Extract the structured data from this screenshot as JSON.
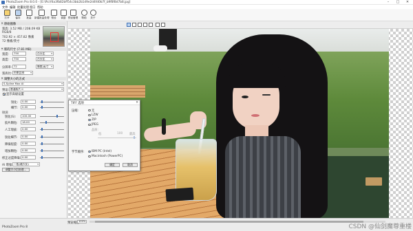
{
  "window": {
    "title": "PhotoZoom Pro 8.0.0 - [E:\\Pic\\f4a3fb82bff54c3bb2b1d9e2d4fd0b7f_b9f8f8d7b8.jpg]",
    "controls": [
      "–",
      "□",
      "✕"
    ]
  },
  "menu": [
    "文件",
    "编辑",
    "批量处理",
    "窗口",
    "帮助"
  ],
  "toolbar": [
    {
      "label": "打开",
      "icon": "open-folder-icon"
    },
    {
      "label": "保存",
      "icon": "save-icon"
    },
    {
      "label": "批量",
      "icon": "batch-icon"
    },
    {
      "label": "新建批量处理",
      "icon": "new-batch-icon"
    },
    {
      "label": "预设",
      "icon": "preset-icon"
    },
    {
      "label": "调整",
      "icon": "adjust-icon"
    },
    {
      "label": "预设管理",
      "icon": "preset-manager-icon"
    },
    {
      "label": "帮助",
      "icon": "help-icon"
    },
    {
      "label": "关于",
      "icon": "info-icon"
    }
  ],
  "panel": {
    "source_section": "原始图像",
    "source_info": [
      "宽高: 3.52 MB / 208.09 KB",
      "RGB/8",
      "702.92 × 457.82 像素",
      "72 像素/英寸"
    ],
    "new_size_section": "新的尺寸 (7.81 MB)",
    "width_label": "宽度:",
    "width_value": "750",
    "width_unit": "百分比",
    "height_label": "高度:",
    "height_value": "750",
    "height_unit": "百分比",
    "res_label": "分辨率:",
    "res_value": "72",
    "res_unit": "像素/英寸",
    "aspect_label": "宽高比:",
    "aspect_value": "约束比例",
    "method_section": "调整大小的方式",
    "method_value": "S-Spline Max AI",
    "preset_label": "预设:",
    "preset_value": "普通照片 II",
    "opt_checkbox": "显示高级设置",
    "adv_rows": [
      {
        "label": "锐化:",
        "value": "0.00"
      },
      {
        "label": "细节:",
        "value": "0.00"
      }
    ],
    "tweak_section": "微调",
    "tweak_rows": [
      {
        "label": "锐化(S):",
        "value": "100.00"
      },
      {
        "label": "胶片颗粒:",
        "value": "18.00"
      },
      {
        "label": "人工瑕疵:",
        "value": "0.00"
      },
      {
        "label": "锐化细节:",
        "value": "0.00"
      },
      {
        "label": "降噪程度:",
        "value": "0.00"
      },
      {
        "label": "增加颗粒:",
        "value": "0.00"
      },
      {
        "label": "修正过度降噪:",
        "value": "0.00"
      }
    ],
    "render_label": "AI 增强:",
    "render_value": "一般(最大化)",
    "fine_button": "调整大小后处理..."
  },
  "dialog": {
    "title": "TIFF 选项",
    "compress_label": "压缩:",
    "compress_options": [
      "无",
      "LZW",
      "ZIP",
      "JPEG"
    ],
    "compress_selected": 2,
    "quality_label": "品质:",
    "quality_scale": [
      "低",
      "100",
      "最高"
    ],
    "byteorder_label": "字节顺序:",
    "byteorder_options": [
      "IBM PC (Intel)",
      "Macintosh (PowerPC)"
    ],
    "byteorder_selected": 0,
    "ok": "确定",
    "cancel": "取消"
  },
  "status": {
    "label": "预览缩放",
    "zoom": "100%",
    "app_name": "PhotoZoom Pro 8",
    "watermark": "CSDN @仙剑魔尊重楼"
  }
}
